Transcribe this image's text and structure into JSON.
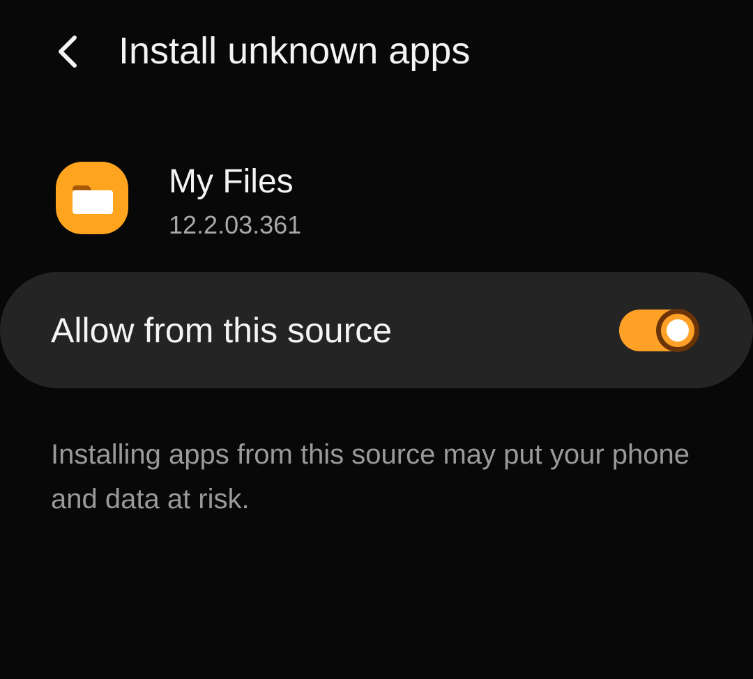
{
  "header": {
    "back_icon": "chevron-left-icon",
    "title": "Install unknown apps"
  },
  "app": {
    "icon": "folder-icon",
    "icon_color": "#ffa41e",
    "name": "My Files",
    "version": "12.2.03.361"
  },
  "setting": {
    "label": "Allow from this source",
    "enabled": true,
    "accent_color": "#ffa127"
  },
  "warning": {
    "text": "Installing apps from this source may put your phone and data at risk."
  }
}
